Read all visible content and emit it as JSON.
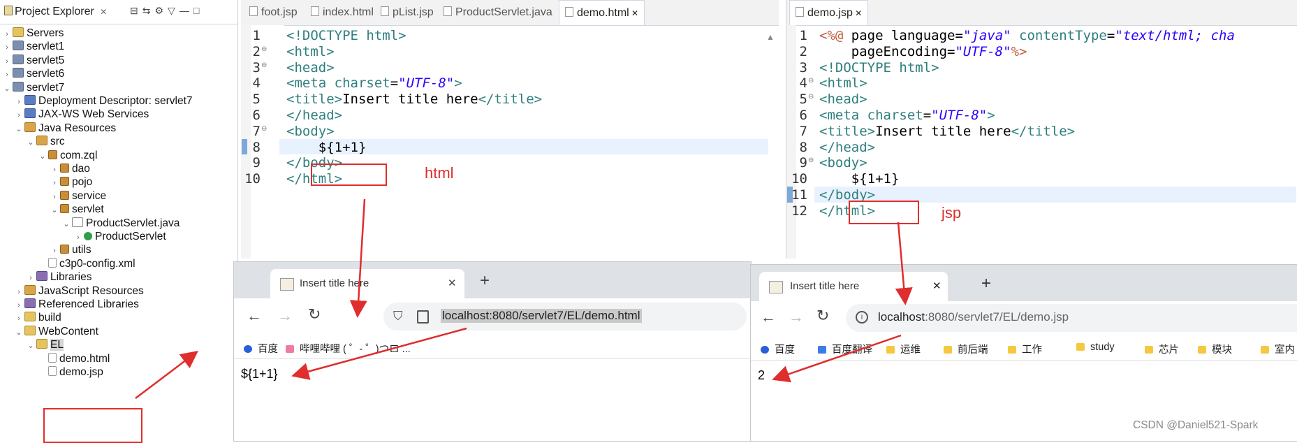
{
  "explorer": {
    "title": "Project Explorer",
    "tree": [
      {
        "label": "Servers",
        "icon": "folder-icon",
        "indent": 0,
        "twisty": "›"
      },
      {
        "label": "servlet1",
        "icon": "project-icon",
        "indent": 0,
        "twisty": "›"
      },
      {
        "label": "servlet5",
        "icon": "project-icon",
        "indent": 0,
        "twisty": "›"
      },
      {
        "label": "servlet6",
        "icon": "project-icon",
        "indent": 0,
        "twisty": "›"
      },
      {
        "label": "servlet7",
        "icon": "project-icon",
        "indent": 0,
        "twisty": "⌄"
      },
      {
        "label": "Deployment Descriptor: servlet7",
        "icon": "descriptor-icon",
        "indent": 1,
        "twisty": "›"
      },
      {
        "label": "JAX-WS Web Services",
        "icon": "webservice-icon",
        "indent": 1,
        "twisty": "›"
      },
      {
        "label": "Java Resources",
        "icon": "java-resources-icon",
        "indent": 1,
        "twisty": "⌄"
      },
      {
        "label": "src",
        "icon": "source-folder-icon",
        "indent": 2,
        "twisty": "⌄"
      },
      {
        "label": "com.zql",
        "icon": "package-icon",
        "indent": 3,
        "twisty": "⌄"
      },
      {
        "label": "dao",
        "icon": "package-icon",
        "indent": 4,
        "twisty": "›"
      },
      {
        "label": "pojo",
        "icon": "package-icon",
        "indent": 4,
        "twisty": "›"
      },
      {
        "label": "service",
        "icon": "package-icon",
        "indent": 4,
        "twisty": "›"
      },
      {
        "label": "servlet",
        "icon": "package-icon",
        "indent": 4,
        "twisty": "⌄"
      },
      {
        "label": "ProductServlet.java",
        "icon": "java-file-icon",
        "indent": 5,
        "twisty": "⌄"
      },
      {
        "label": "ProductServlet",
        "icon": "class-icon",
        "indent": 6,
        "twisty": "›"
      },
      {
        "label": "utils",
        "icon": "package-icon",
        "indent": 4,
        "twisty": "›"
      },
      {
        "label": "c3p0-config.xml",
        "icon": "xml-file-icon",
        "indent": 3,
        "twisty": ""
      },
      {
        "label": "Libraries",
        "icon": "library-icon",
        "indent": 2,
        "twisty": "›"
      },
      {
        "label": "JavaScript Resources",
        "icon": "js-resources-icon",
        "indent": 1,
        "twisty": "›"
      },
      {
        "label": "Referenced Libraries",
        "icon": "library-icon",
        "indent": 1,
        "twisty": "›"
      },
      {
        "label": "build",
        "icon": "folder-icon",
        "indent": 1,
        "twisty": "›"
      },
      {
        "label": "WebContent",
        "icon": "folder-icon",
        "indent": 1,
        "twisty": "⌄"
      },
      {
        "label": "EL",
        "icon": "folder-open-icon",
        "indent": 2,
        "twisty": "⌄"
      },
      {
        "label": "demo.html",
        "icon": "html-file-icon",
        "indent": 3,
        "twisty": ""
      },
      {
        "label": "demo.jsp",
        "icon": "jsp-file-icon",
        "indent": 3,
        "twisty": ""
      }
    ]
  },
  "editor_left": {
    "tabs": [
      "foot.jsp",
      "index.html",
      "pList.jsp",
      "ProductServlet.java",
      "demo.html"
    ],
    "active_tab": "demo.html",
    "line_numbers": [
      "1",
      "2",
      "3",
      "4",
      "5",
      "6",
      "7",
      "8",
      "9",
      "10"
    ],
    "lines": [
      "<!DOCTYPE html>",
      "<html>",
      "<head>",
      "<meta charset=\"UTF-8\">",
      "<title>Insert title here</title>",
      "</head>",
      "<body>",
      "    ${1+1}",
      "</body>",
      "</html>"
    ],
    "annotation": "html"
  },
  "editor_right": {
    "tabs": [
      "demo.jsp"
    ],
    "line_numbers": [
      "1",
      "2",
      "3",
      "4",
      "5",
      "6",
      "7",
      "8",
      "9",
      "10",
      "11",
      "12"
    ],
    "lines": [
      "<%@ page language=\"java\" contentType=\"text/html; cha",
      "    pageEncoding=\"UTF-8\"%>",
      "<!DOCTYPE html>",
      "<html>",
      "<head>",
      "<meta charset=\"UTF-8\">",
      "<title>Insert title here</title>",
      "</head>",
      "<body>",
      "    ${1+1}",
      "</body>",
      "</html>"
    ],
    "annotation": "jsp"
  },
  "browser_left": {
    "tab_title": "Insert title here",
    "url": "localhost:8080/servlet7/EL/demo.html",
    "bookmarks": [
      "百度",
      "哔哩哔哩 ( ゜- ゜)つロ ..."
    ],
    "content": "${1+1}"
  },
  "browser_right": {
    "tab_title": "Insert title here",
    "url_host": "localhost",
    "url_rest": ":8080/servlet7/EL/demo.jsp",
    "bookmarks": [
      "百度",
      "百度翻译",
      "运维",
      "前后端",
      "工作",
      "study",
      "芯片",
      "模块",
      "室内"
    ],
    "content": "2"
  },
  "watermark": "CSDN @Daniel521-Spark",
  "colors": {
    "annotation_red": "#e02d2d",
    "tag_teal": "#2f7f7f",
    "attr_purple": "#7f0055",
    "value_blue": "#2a00ff"
  }
}
